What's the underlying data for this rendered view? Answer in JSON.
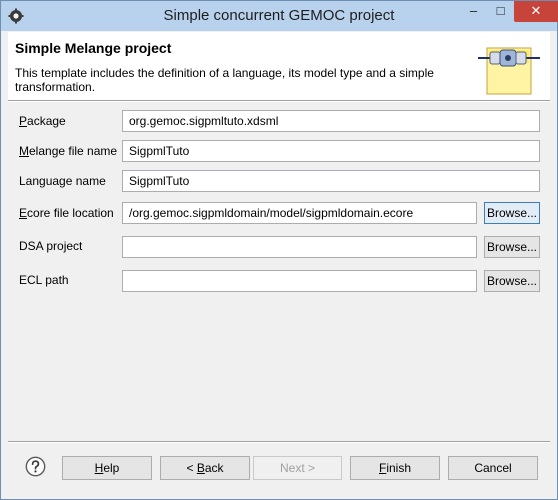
{
  "window": {
    "title": "Simple concurrent GEMOC project"
  },
  "window_controls": {
    "minimize": "–",
    "maximize": "□",
    "close": "✕"
  },
  "header": {
    "title": "Simple Melange project",
    "description": "This template includes the definition of a language, its model type and a simple transformation."
  },
  "fields": [
    {
      "mnemonic": "P",
      "label_rest": "ackage",
      "value": "org.gemoc.sigpmltuto.xdsml",
      "browse": ""
    },
    {
      "mnemonic": "M",
      "label_rest": "elange file name",
      "value": "SigpmlTuto",
      "browse": ""
    },
    {
      "mnemonic": "",
      "label_rest": "Language name",
      "value": "SigpmlTuto",
      "browse": ""
    },
    {
      "mnemonic": "E",
      "label_rest": "core file location",
      "value": "/org.gemoc.sigpmldomain/model/sigpmldomain.ecore",
      "browse": "Browse..."
    },
    {
      "mnemonic": "",
      "label_rest": "DSA project",
      "value": "",
      "browse": "Browse..."
    },
    {
      "mnemonic": "",
      "label_rest": "ECL path",
      "value": "",
      "browse": "Browse..."
    }
  ],
  "buttons": {
    "help": {
      "mnemonic": "H",
      "rest": "elp"
    },
    "back": {
      "prefix": "< ",
      "mnemonic": "B",
      "rest": "ack"
    },
    "next": {
      "label": "Next >"
    },
    "finish": {
      "mnemonic": "F",
      "rest": "inish"
    },
    "cancel": {
      "label": "Cancel"
    }
  },
  "icons": {
    "app": "eclipse-gear-icon",
    "header": "melange-plugin-icon",
    "help": "question-mark-icon"
  },
  "colors": {
    "title_bar": "#b8d2ee",
    "close_button": "#c7443b",
    "dialog_bg": "#f0f0f0"
  }
}
